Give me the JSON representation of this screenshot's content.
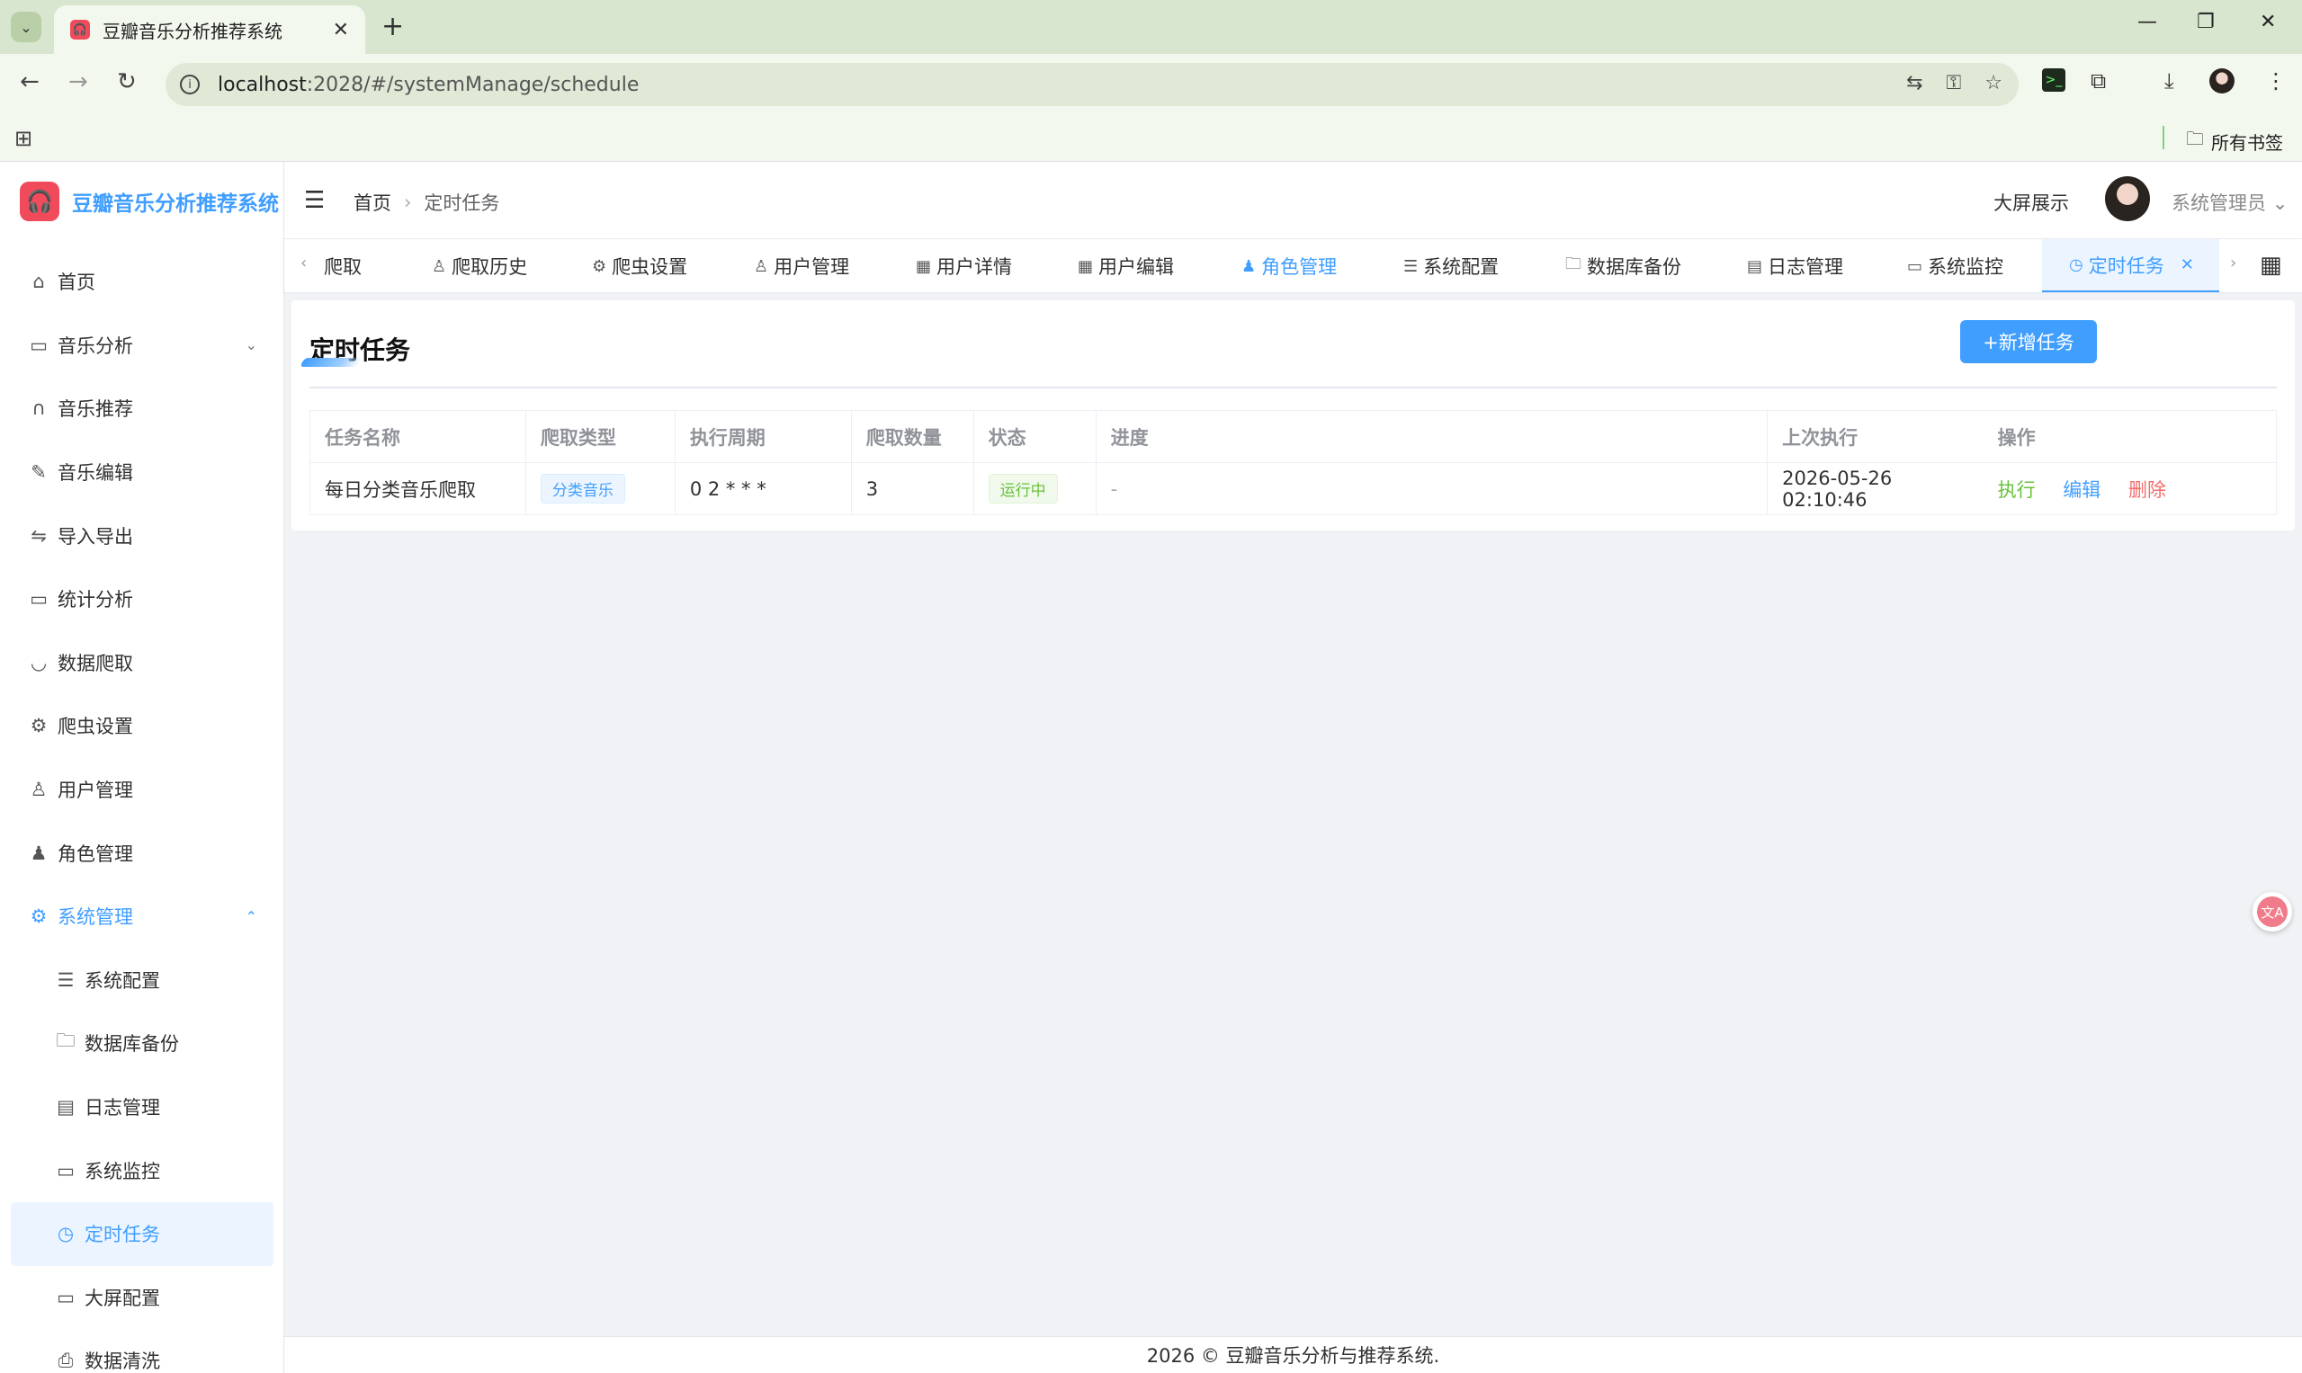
{
  "browser": {
    "tab_title": "豆瓣音乐分析推荐系统",
    "url_host": "localhost",
    "url_rest": ":2028/#/systemManage/schedule",
    "bookmarks_all": "所有书签"
  },
  "app": {
    "logo_text": "豆瓣音乐分析推荐系统",
    "sidebar": {
      "items": [
        {
          "label": "首页",
          "icon": "home-icon"
        },
        {
          "label": "音乐分析",
          "icon": "presentation-icon"
        },
        {
          "label": "音乐推荐",
          "icon": "headphones-icon"
        },
        {
          "label": "音乐编辑",
          "icon": "pen-icon"
        },
        {
          "label": "导入导出",
          "icon": "arrows-icon"
        },
        {
          "label": "统计分析",
          "icon": "presentation-icon"
        },
        {
          "label": "数据爬取",
          "icon": "bowl-icon"
        },
        {
          "label": "爬虫设置",
          "icon": "gear-icon"
        },
        {
          "label": "用户管理",
          "icon": "user-icon"
        },
        {
          "label": "角色管理",
          "icon": "user-solid-icon"
        },
        {
          "label": "系统管理",
          "icon": "gear-icon"
        }
      ],
      "sub_items": [
        {
          "label": "系统配置",
          "icon": "sliders-icon"
        },
        {
          "label": "数据库备份",
          "icon": "folder-icon"
        },
        {
          "label": "日志管理",
          "icon": "document-icon"
        },
        {
          "label": "系统监控",
          "icon": "monitor-icon"
        },
        {
          "label": "定时任务",
          "icon": "timer-icon"
        },
        {
          "label": "大屏配置",
          "icon": "screen-icon"
        },
        {
          "label": "数据清洗",
          "icon": "printer-icon"
        }
      ]
    },
    "navbar": {
      "breadcrumb_home": "首页",
      "breadcrumb_current": "定时任务",
      "screen_link": "大屏展示",
      "user_name": "系统管理员"
    },
    "tags": [
      {
        "label": "爬取"
      },
      {
        "label": "爬取历史"
      },
      {
        "label": "爬虫设置"
      },
      {
        "label": "用户管理"
      },
      {
        "label": "用户详情"
      },
      {
        "label": "用户编辑"
      },
      {
        "label": "角色管理"
      },
      {
        "label": "系统配置"
      },
      {
        "label": "数据库备份"
      },
      {
        "label": "日志管理"
      },
      {
        "label": "系统监控"
      },
      {
        "label": "定时任务"
      }
    ],
    "page": {
      "title": "定时任务",
      "add_button": "+新增任务",
      "columns": [
        "任务名称",
        "爬取类型",
        "执行周期",
        "爬取数量",
        "状态",
        "进度",
        "上次执行",
        "操作"
      ],
      "rows": [
        {
          "name": "每日分类音乐爬取",
          "type": "分类音乐",
          "cron": "0 2 * * *",
          "count": "3",
          "status": "运行中",
          "progress": "-",
          "last_run": "2026-05-26 02:10:46",
          "ops": {
            "run": "执行",
            "edit": "编辑",
            "delete": "删除"
          }
        }
      ]
    },
    "footer": "2026 © 豆瓣音乐分析与推荐系统."
  },
  "colors": {
    "primary": "#409eff",
    "success": "#67c23a",
    "danger": "#f56c6c",
    "brand": "#f04a5b"
  }
}
